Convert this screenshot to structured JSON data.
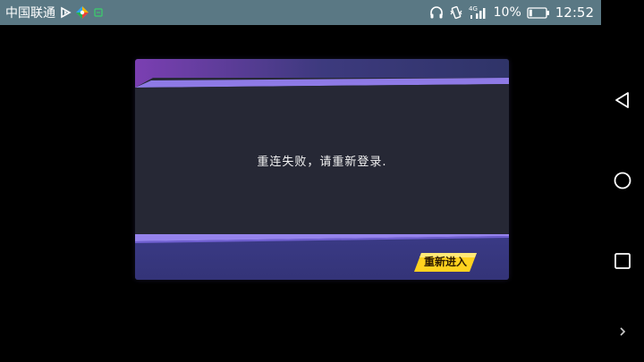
{
  "status_bar": {
    "carrier": "中国联通",
    "battery": "10%",
    "time": "12:52",
    "network": "4G",
    "background_color": "#5a7884",
    "left_icons": [
      "play-icon",
      "colorful-app-icon",
      "sim-icon"
    ],
    "right_icons": [
      "headphones-icon",
      "vibrate-icon",
      "signal-icon",
      "battery-icon"
    ]
  },
  "nav_bar": {
    "icons": [
      "back-icon",
      "home-icon",
      "recents-icon",
      "expand-icon"
    ]
  },
  "dialog": {
    "message": "重连失败，请重新登录.",
    "button_label": "重新进入",
    "accent_color": "#7a63d6",
    "button_color": "#ffd21f"
  }
}
